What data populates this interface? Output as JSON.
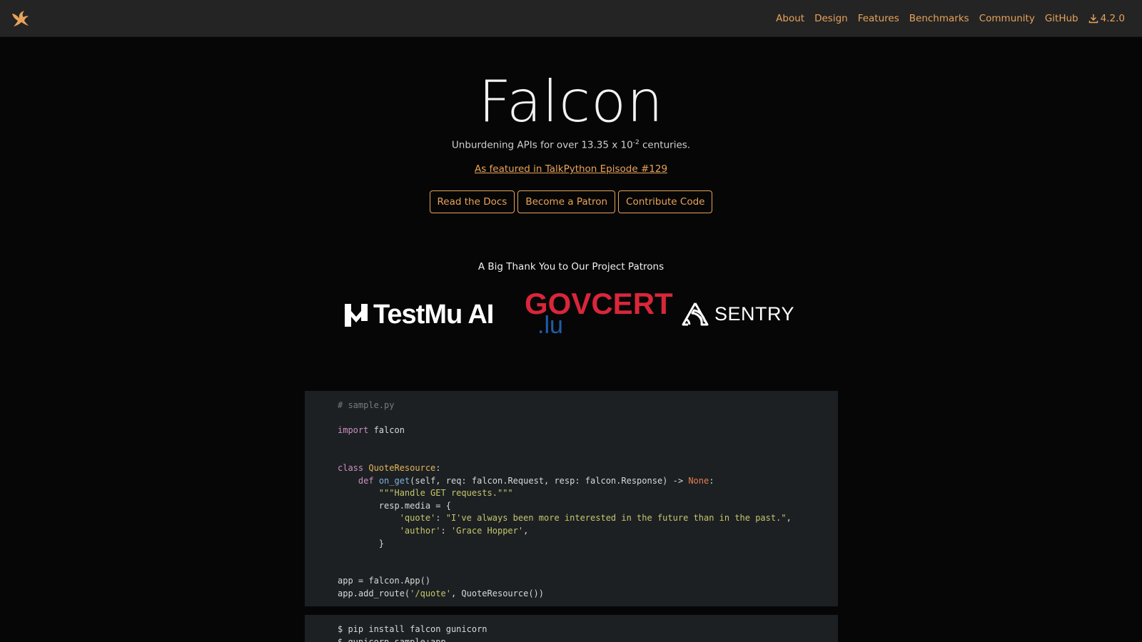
{
  "nav": {
    "links": [
      "About",
      "Design",
      "Features",
      "Benchmarks",
      "Community",
      "GitHub"
    ],
    "version": "4.2.0",
    "accent": "#e8a35a"
  },
  "hero": {
    "title": "Falcon",
    "tagline_prefix": "Unburdening APIs for over 13.35 x 10",
    "tagline_exp": "-2",
    "tagline_suffix": " centuries.",
    "featured": "As featured in TalkPython Episode #129",
    "buttons": [
      "Read the Docs",
      "Become a Patron",
      "Contribute Code"
    ]
  },
  "patrons": {
    "title": "A Big Thank You to Our Project Patrons",
    "testmu": "TestMu AI",
    "govcert_main": "GOVCERT",
    "govcert_sub": ".lu",
    "sentry": "SENTRY"
  },
  "code_sample": {
    "comment": "# sample.py",
    "import_kw": "import",
    "import_mod": " falcon",
    "class_kw": "class",
    "class_name": " QuoteResource",
    "class_colon": ":",
    "def_indent": "    ",
    "def_kw": "def",
    "fn_name": " on_get",
    "fn_args": "(self, req: falcon.Request, resp: falcon.Response) -> ",
    "fn_ret": "None",
    "fn_colon": ":",
    "docstring": "        \"\"\"Handle GET requests.\"\"\"",
    "media_open": "        resp.media = {",
    "quote_key": "            'quote'",
    "quote_sep": ": ",
    "quote_val": "\"I've always been more interested in the future than in the past.\"",
    "quote_comma": ",",
    "author_key": "            'author'",
    "author_sep": ": ",
    "author_val": "'Grace Hopper'",
    "author_comma": ",",
    "media_close": "        }",
    "app_line": "app = falcon.App()",
    "route_prefix": "app.add_route(",
    "route_path": "'/quote'",
    "route_suffix": ", QuoteResource())"
  },
  "install": {
    "line1": "$ pip install falcon gunicorn",
    "line2": "$ gunicorn sample:app"
  }
}
